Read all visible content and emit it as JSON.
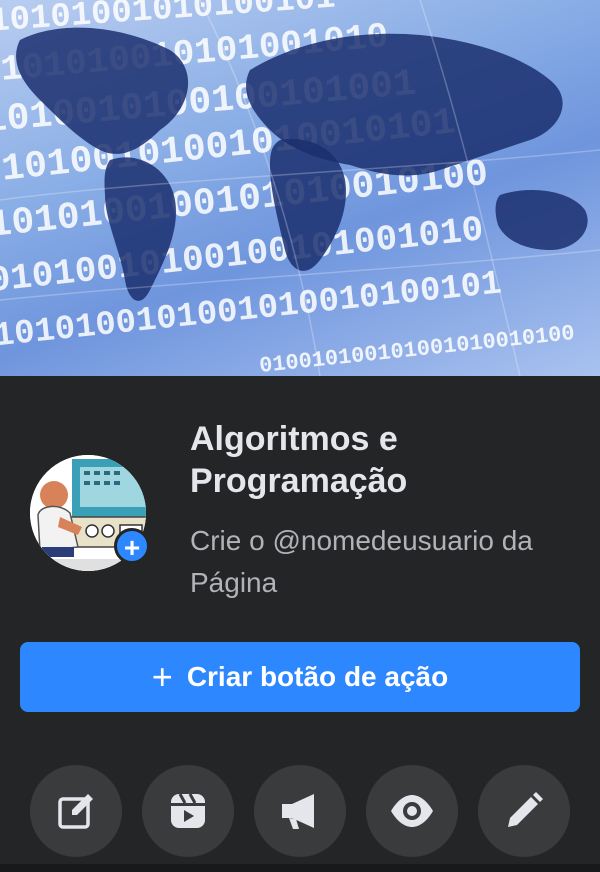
{
  "page": {
    "name": "Algoritmos e Programação",
    "username_prompt": "Crie o @nomedeusuario da Página"
  },
  "actions": {
    "create_action_label": "Criar botão de ação"
  },
  "toolbar": {
    "buttons": [
      {
        "icon": "edit-square-icon"
      },
      {
        "icon": "reels-icon"
      },
      {
        "icon": "megaphone-icon"
      },
      {
        "icon": "eye-icon"
      },
      {
        "icon": "pencil-icon"
      }
    ]
  },
  "cover": {
    "digits_line1": "10101001010100101",
    "digits_line2": "0101010010101001010",
    "digits_line3": "1010010100100101001",
    "digits_line4": "010100101001010010101",
    "digits_line5": "1010100100101010010100",
    "digits_line6": "01010010100100101001010",
    "digits_line7": "1010100101001010010100101",
    "digits_line8": "010010100101001010010100"
  },
  "colors": {
    "accent": "#2d88ff",
    "background": "#242526",
    "icon_circle": "#3a3b3c"
  }
}
